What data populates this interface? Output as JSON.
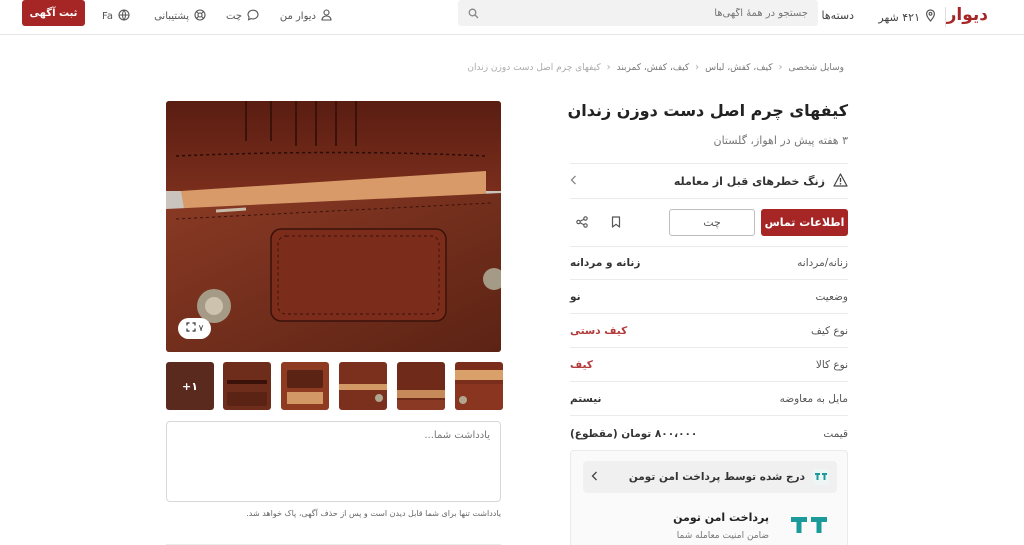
{
  "header": {
    "logo": "دیوار",
    "city": "۴۲۱ شهر",
    "categories": "دسته‌ها",
    "search_placeholder": "جستجو در همهٔ آگهی‌ها",
    "my_divar": "دیوار من",
    "chat": "چت",
    "support": "پشتیبانی",
    "lang": "Fa",
    "post_button": "ثبت آگهی"
  },
  "breadcrumb": [
    "وسایل شخصی",
    "کیف، کفش، لباس",
    "کیف، کفش، کمربند",
    "کیفهای چرم اصل دست دوزن زندان"
  ],
  "ad": {
    "title": "کیفهای چرم اصل دست دوزن زندان",
    "subtitle": "۳ هفته پیش در اهواز، گلستان",
    "alert": "زنگ خطرهای قبل از معامله",
    "contact_button": "اطلاعات تماس",
    "chat_button": "چت",
    "attributes": [
      {
        "key": "زنانه/مردانه",
        "value": "زنانه و مردانه",
        "link": false
      },
      {
        "key": "وضعیت",
        "value": "نو",
        "link": false
      },
      {
        "key": "نوع کیف",
        "value": "کیف دستی",
        "link": true
      },
      {
        "key": "نوع کالا",
        "value": "کیف",
        "link": true
      },
      {
        "key": "مایل به معاوضه",
        "value": "نیستم",
        "link": false
      },
      {
        "key": "قیمت",
        "value": "۸۰۰،۰۰۰ تومان (مقطوع)",
        "link": false
      }
    ],
    "tooman": {
      "banner": "درج شده توسط پرداخت امن تومن",
      "title": "پرداخت امن تومن",
      "subtitle": "ضامن امنیت معامله شما"
    },
    "gallery": {
      "image_count": "۷",
      "more_label": "+۱"
    },
    "note": {
      "placeholder": "یادداشت شما...",
      "hint": "یادداشت تنها برای شما قابل دیدن است و پس از حذف آگهی، پاک خواهد شد."
    }
  },
  "colors": {
    "brand": "#a62626",
    "link": "#b33a3a"
  }
}
